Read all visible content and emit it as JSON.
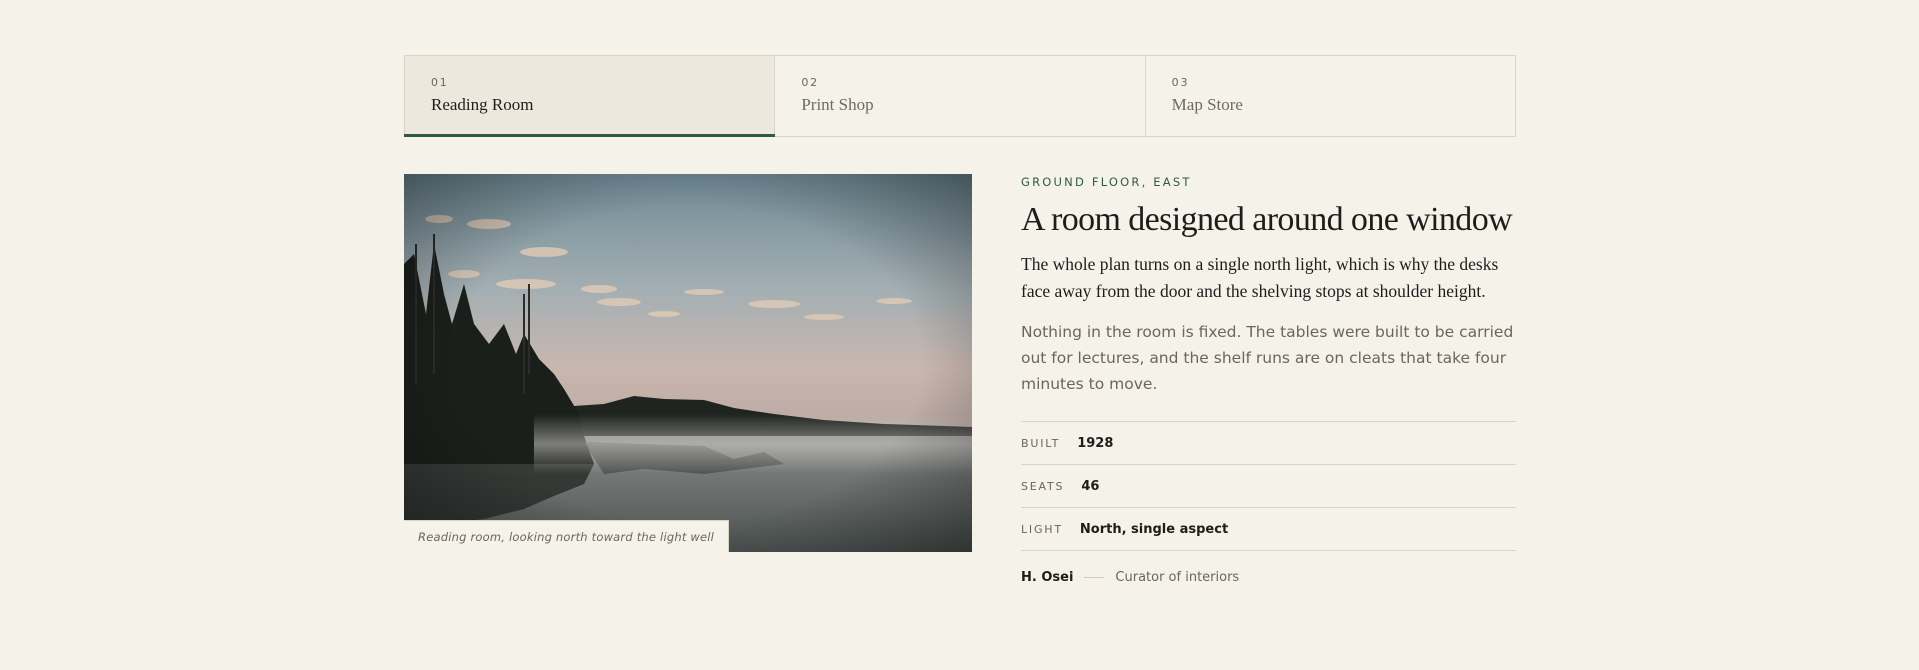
{
  "tabs": [
    {
      "num": "01",
      "label": "Reading Room"
    },
    {
      "num": "02",
      "label": "Print Shop"
    },
    {
      "num": "03",
      "label": "Map Store"
    }
  ],
  "photo": {
    "caption": "Reading room, looking north toward the light well"
  },
  "section": {
    "eyebrow": "GROUND FLOOR, EAST",
    "headline": "A room designed around one window",
    "lede": "The whole plan turns on a single north light, which is why the desks face away from the door and the shelving stops at shoulder height.",
    "body": "Nothing in the room is fixed. The tables were built to be carried out for lectures, and the shelf runs are on cleats that take four minutes to move."
  },
  "facts": [
    {
      "key": "BUILT",
      "value": "1928"
    },
    {
      "key": "SEATS",
      "value": "46"
    },
    {
      "key": "LIGHT",
      "value": "North, single aspect"
    }
  ],
  "byline": {
    "name": "H. Osei",
    "role": "Curator of interiors"
  },
  "colors": {
    "accent": "#2f5a47",
    "background": "#f5f2ea",
    "active_tab": "#ede8dd"
  }
}
